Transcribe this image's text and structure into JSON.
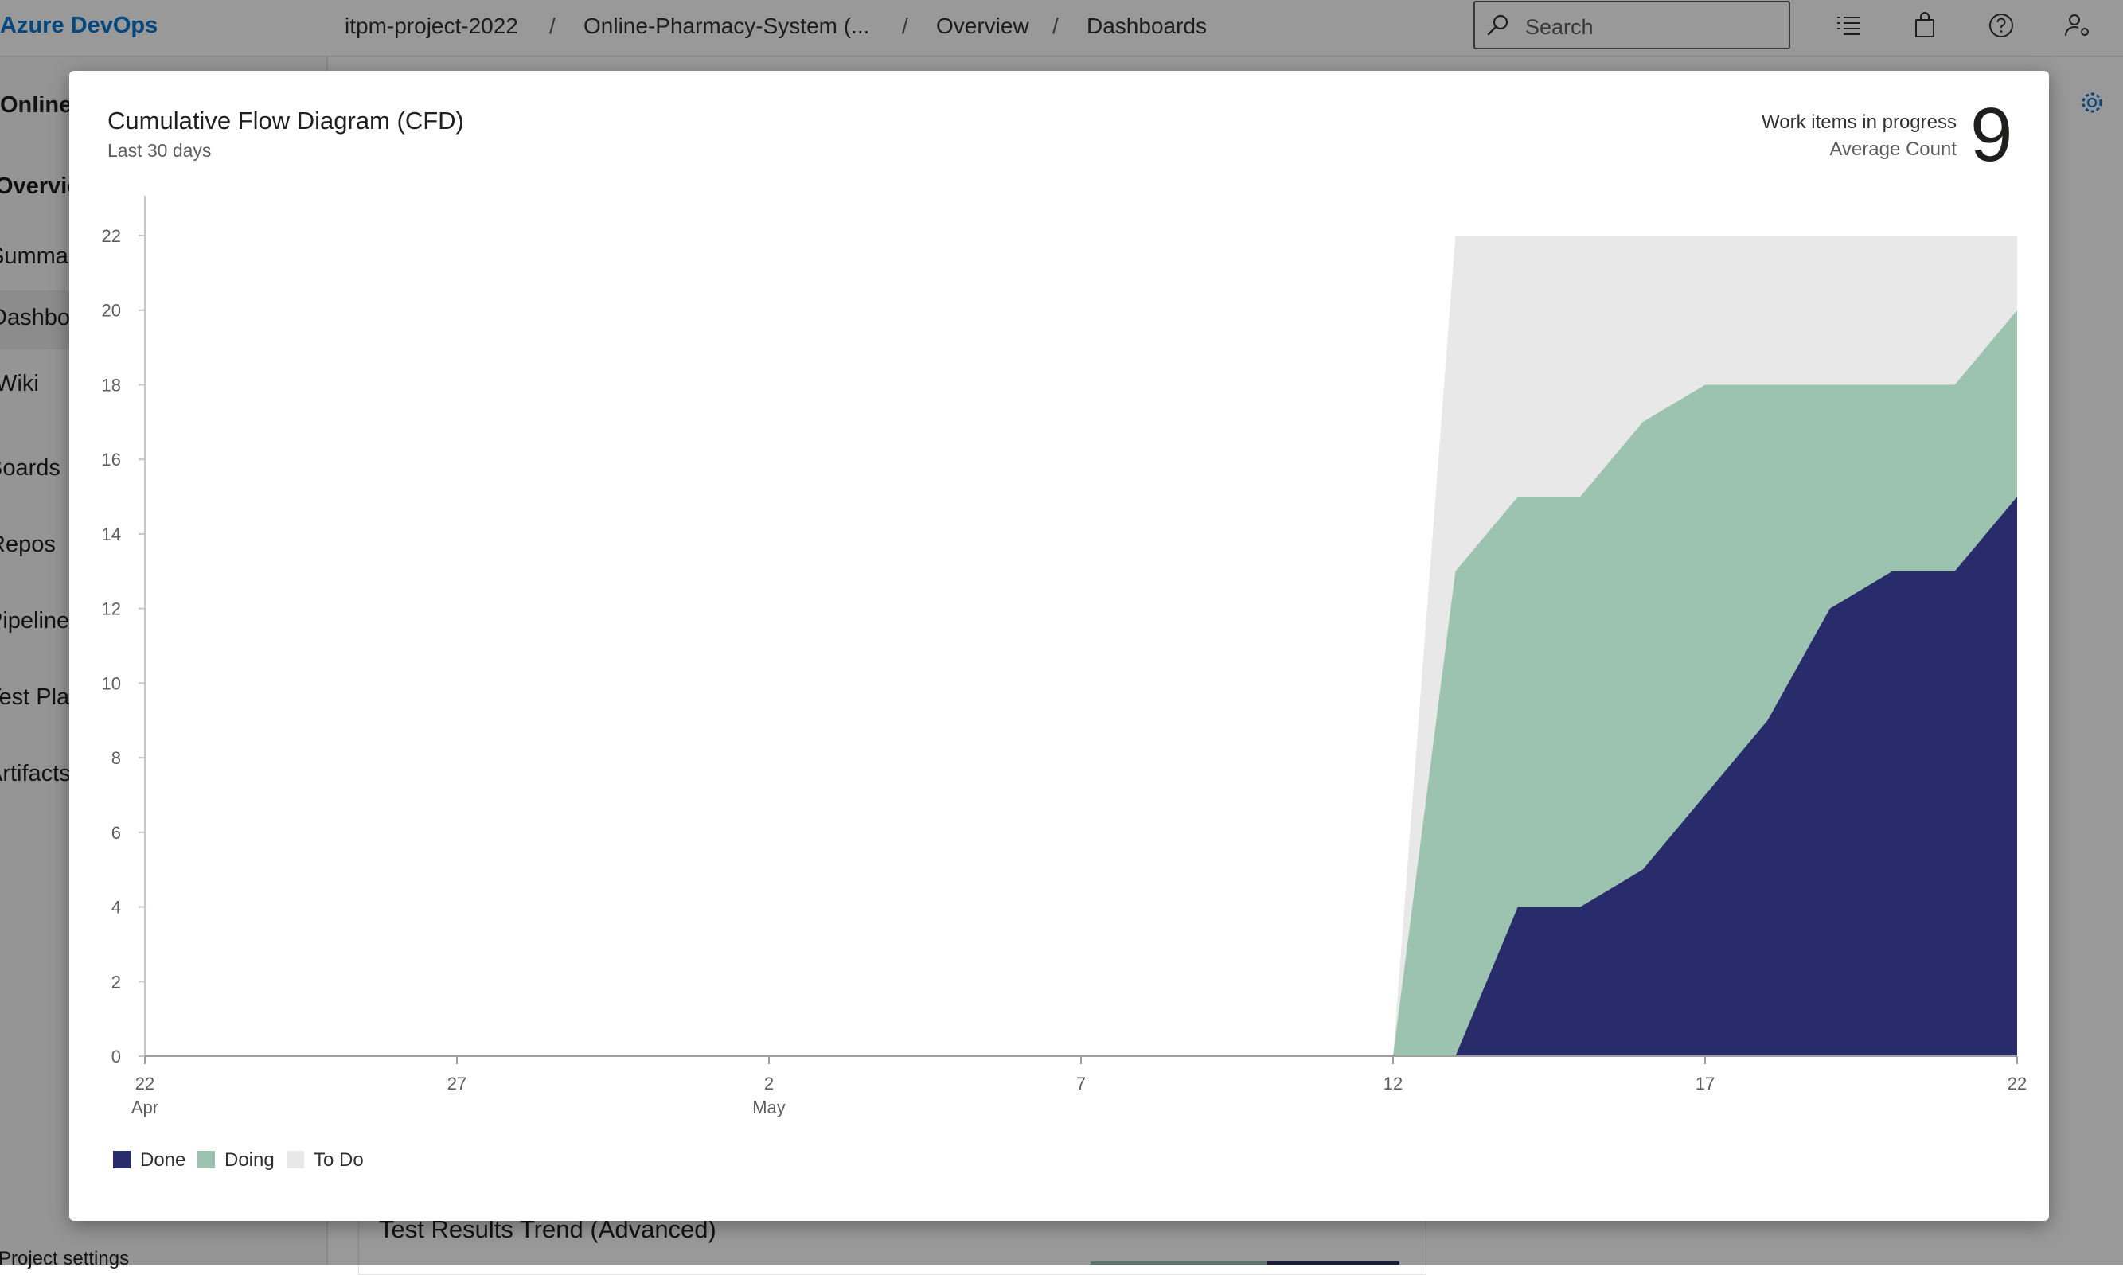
{
  "header": {
    "brand": "Azure DevOps",
    "breadcrumbs": [
      "itpm-project-2022",
      "Online-Pharmacy-System (...",
      "Overview",
      "Dashboards"
    ],
    "separator": "/",
    "search_placeholder": "Search"
  },
  "sidebar": {
    "project": "Online-I",
    "items": [
      {
        "label": "Overview"
      },
      {
        "label": "Summary"
      },
      {
        "label": "Dashboards"
      },
      {
        "label": "Wiki"
      },
      {
        "label": "Boards"
      },
      {
        "label": "Repos"
      },
      {
        "label": "Pipelines"
      },
      {
        "label": "Test Plans"
      },
      {
        "label": "Artifacts"
      }
    ],
    "footer": "Project settings"
  },
  "background": {
    "card_title": "Test Results Trend (Advanced)"
  },
  "modal": {
    "title": "Cumulative Flow Diagram (CFD)",
    "subtitle": "Last 30 days",
    "kpi_label": "Work items in progress",
    "kpi_sublabel": "Average Count",
    "kpi_value": "9"
  },
  "colors": {
    "done": "#292c6a",
    "doing": "#9cc3b0",
    "todo": "#e8e8e8",
    "brand": "#0078d4"
  },
  "chart_data": {
    "type": "area",
    "stacked": true,
    "title": "Cumulative Flow Diagram (CFD)",
    "subtitle": "Last 30 days",
    "x_axis": {
      "start": "2022-04-22",
      "end": "2022-05-22",
      "ticks": [
        {
          "day": 0,
          "label": "22",
          "sublabel": "Apr"
        },
        {
          "day": 5,
          "label": "27",
          "sublabel": ""
        },
        {
          "day": 10,
          "label": "2",
          "sublabel": "May"
        },
        {
          "day": 15,
          "label": "7",
          "sublabel": ""
        },
        {
          "day": 20,
          "label": "12",
          "sublabel": ""
        },
        {
          "day": 25,
          "label": "17",
          "sublabel": ""
        },
        {
          "day": 30,
          "label": "22",
          "sublabel": ""
        }
      ]
    },
    "ylim": [
      0,
      22
    ],
    "y_ticks": [
      0,
      2,
      4,
      6,
      8,
      10,
      12,
      14,
      16,
      18,
      20,
      22
    ],
    "series": [
      {
        "name": "Done",
        "color": "#292c6a",
        "points": [
          [
            0,
            0
          ],
          [
            21,
            0
          ],
          [
            22,
            4
          ],
          [
            23,
            4
          ],
          [
            24,
            5
          ],
          [
            25,
            7
          ],
          [
            26,
            9
          ],
          [
            27,
            12
          ],
          [
            28,
            13
          ],
          [
            29,
            13
          ],
          [
            30,
            15
          ]
        ]
      },
      {
        "name": "Doing",
        "color": "#9cc3b0",
        "points": [
          [
            0,
            0
          ],
          [
            20,
            0
          ],
          [
            21,
            13
          ],
          [
            22,
            15
          ],
          [
            23,
            15
          ],
          [
            24,
            17
          ],
          [
            25,
            18
          ],
          [
            26,
            18
          ],
          [
            27,
            18
          ],
          [
            28,
            18
          ],
          [
            29,
            18
          ],
          [
            30,
            20
          ]
        ]
      },
      {
        "name": "To Do",
        "color": "#e8e8e8",
        "points": [
          [
            0,
            0
          ],
          [
            20,
            0
          ],
          [
            21,
            22
          ],
          [
            22,
            22
          ],
          [
            23,
            22
          ],
          [
            24,
            22
          ],
          [
            25,
            22
          ],
          [
            26,
            22
          ],
          [
            27,
            22
          ],
          [
            28,
            22
          ],
          [
            29,
            22
          ],
          [
            30,
            22
          ]
        ]
      }
    ],
    "legend": [
      "Done",
      "Doing",
      "To Do"
    ],
    "legend_position": "bottom-left"
  }
}
